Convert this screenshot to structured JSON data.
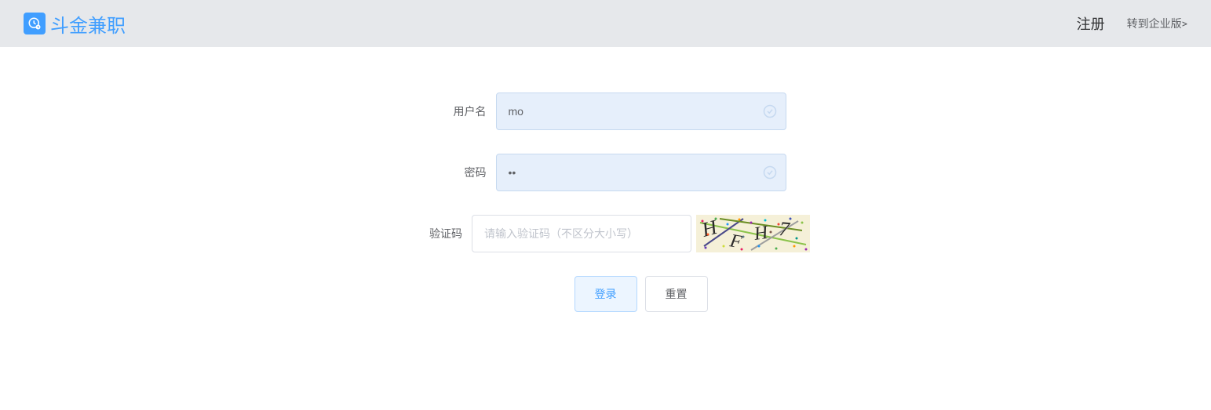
{
  "header": {
    "brand_name": "斗金兼职",
    "register_label": "注册",
    "enterprise_label": "转到企业版>"
  },
  "form": {
    "username": {
      "label": "用户名",
      "value": "mo"
    },
    "password": {
      "label": "密码",
      "value": "••"
    },
    "captcha": {
      "label": "验证码",
      "placeholder": "请输入验证码（不区分大小写）",
      "value": ""
    },
    "buttons": {
      "login": "登录",
      "reset": "重置"
    }
  }
}
